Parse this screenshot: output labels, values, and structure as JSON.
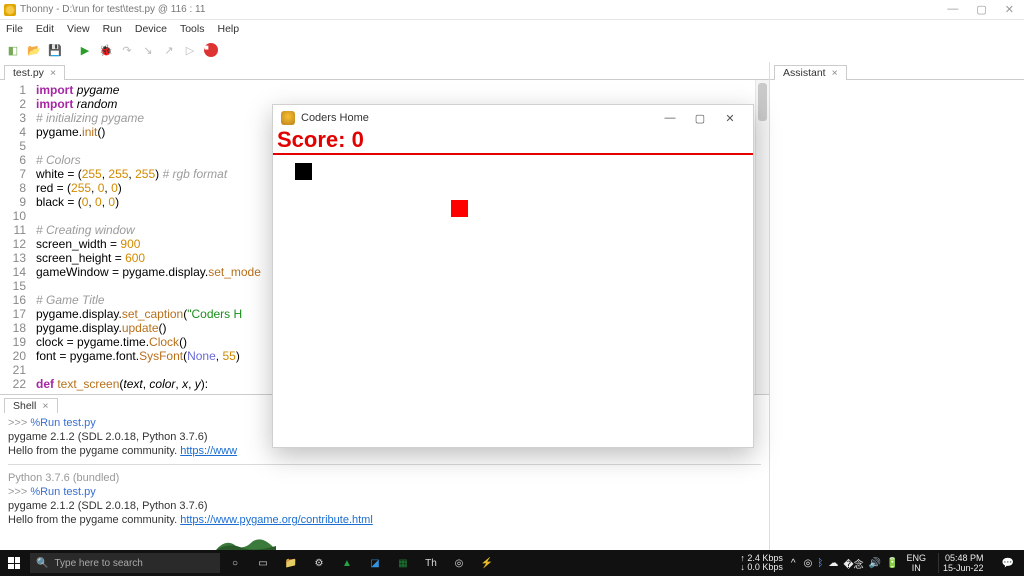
{
  "window": {
    "app": "Thonny",
    "file": "D:\\run for test\\test.py",
    "cursor": "116 : 11",
    "title_combined": "Thonny  -  D:\\run for test\\test.py  @  116 : 11"
  },
  "menu": [
    "File",
    "Edit",
    "View",
    "Run",
    "Device",
    "Tools",
    "Help"
  ],
  "toolbar": [
    "new",
    "open",
    "save",
    "run",
    "debug",
    "step-over",
    "step-in",
    "step-out",
    "resume",
    "stop"
  ],
  "tab": {
    "label": "test.py"
  },
  "assistant": {
    "title": "Assistant"
  },
  "code": {
    "lines": [
      {
        "n": 1,
        "html": "<span class='kw'>import</span> <span class='mod'>pygame</span>"
      },
      {
        "n": 2,
        "html": "<span class='kw'>import</span> <span class='mod'>random</span>"
      },
      {
        "n": 3,
        "html": "<span class='cm'># initializing pygame</span>"
      },
      {
        "n": 4,
        "html": "pygame.<span class='fn'>init</span>()"
      },
      {
        "n": 5,
        "html": ""
      },
      {
        "n": 6,
        "html": "<span class='cm'># Colors</span>"
      },
      {
        "n": 7,
        "html": "white = (<span class='num'>255</span>, <span class='num'>255</span>, <span class='num'>255</span>) <span class='cm'># rgb format</span>"
      },
      {
        "n": 8,
        "html": "red = (<span class='num'>255</span>, <span class='num'>0</span>, <span class='num'>0</span>)"
      },
      {
        "n": 9,
        "html": "black = (<span class='num'>0</span>, <span class='num'>0</span>, <span class='num'>0</span>)"
      },
      {
        "n": 10,
        "html": ""
      },
      {
        "n": 11,
        "html": "<span class='cm'># Creating window</span>"
      },
      {
        "n": 12,
        "html": "screen_width = <span class='num'>900</span>"
      },
      {
        "n": 13,
        "html": "screen_height = <span class='num'>600</span>"
      },
      {
        "n": 14,
        "html": "gameWindow = pygame.display.<span class='fn'>set_mode</span>"
      },
      {
        "n": 15,
        "html": ""
      },
      {
        "n": 16,
        "html": "<span class='cm'># Game Title</span>"
      },
      {
        "n": 17,
        "html": "pygame.display.<span class='fn'>set_caption</span>(<span class='str'>\"Coders H</span>"
      },
      {
        "n": 18,
        "html": "pygame.display.<span class='fn'>update</span>()"
      },
      {
        "n": 19,
        "html": "clock = pygame.time.<span class='fn'>Clock</span>()"
      },
      {
        "n": 20,
        "html": "font = pygame.font.<span class='fn'>SysFont</span>(<span class='blue'>None</span>, <span class='num'>55</span>)"
      },
      {
        "n": 21,
        "html": ""
      },
      {
        "n": 22,
        "html": "<span class='def'>def</span> <span class='fn'>text_screen</span>(<span class='arg'>text</span>, <span class='arg'>color</span>, <span class='arg'>x</span>, <span class='arg'>y</span>):"
      }
    ]
  },
  "shell": {
    "title": "Shell",
    "lines1": [
      ">>> %Run test.py",
      " pygame 2.1.2 (SDL 2.0.18, Python 3.7.6)",
      " Hello from the pygame community. https://www"
    ],
    "python": "Python 3.7.6 (bundled)",
    "lines2": [
      ">>> %Run test.py",
      " pygame 2.1.2 (SDL 2.0.18, Python 3.7.6)",
      " Hello from the pygame community. https://www.pygame.org/contribute.html"
    ]
  },
  "pg": {
    "title": "Coders Home",
    "score_label": "Score: 0",
    "score_value": 0
  },
  "taskbar": {
    "search_placeholder": "Type here to search",
    "net_up": "2.4 Kbps",
    "net_dn": "0.0 Kbps",
    "lang": "ENG",
    "region": "IN",
    "time": "05:48 PM",
    "date": "15-Jun-22"
  }
}
